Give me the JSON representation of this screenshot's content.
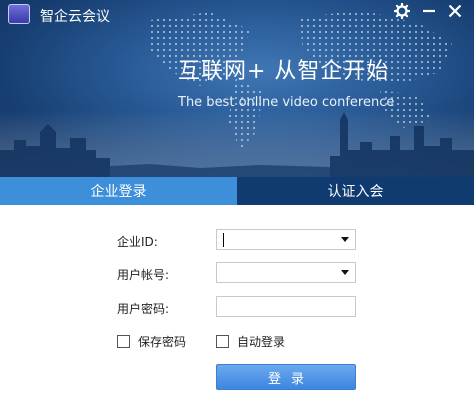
{
  "window": {
    "title": "智企云会议",
    "settings_icon": "gear-icon",
    "minimize_icon": "minimize-icon",
    "close_icon": "close-icon"
  },
  "banner": {
    "slogan": "互联网+ 从智企开始",
    "subslogan": "The best online video conference"
  },
  "tabs": [
    {
      "label": "企业登录",
      "active": true
    },
    {
      "label": "认证入会",
      "active": false
    }
  ],
  "form": {
    "enterprise_id": {
      "label": "企业ID:",
      "value": ""
    },
    "username": {
      "label": "用户帐号:",
      "value": ""
    },
    "password": {
      "label": "用户密码:",
      "value": ""
    },
    "remember_password": {
      "label": "保存密码",
      "checked": false
    },
    "auto_login": {
      "label": "自动登录",
      "checked": false
    },
    "login_button": "登录"
  },
  "colors": {
    "banner": "#2a5c98",
    "tab_active": "#3d8fd9",
    "tab_inactive": "#0f3b70",
    "button": "#4a90e2"
  }
}
